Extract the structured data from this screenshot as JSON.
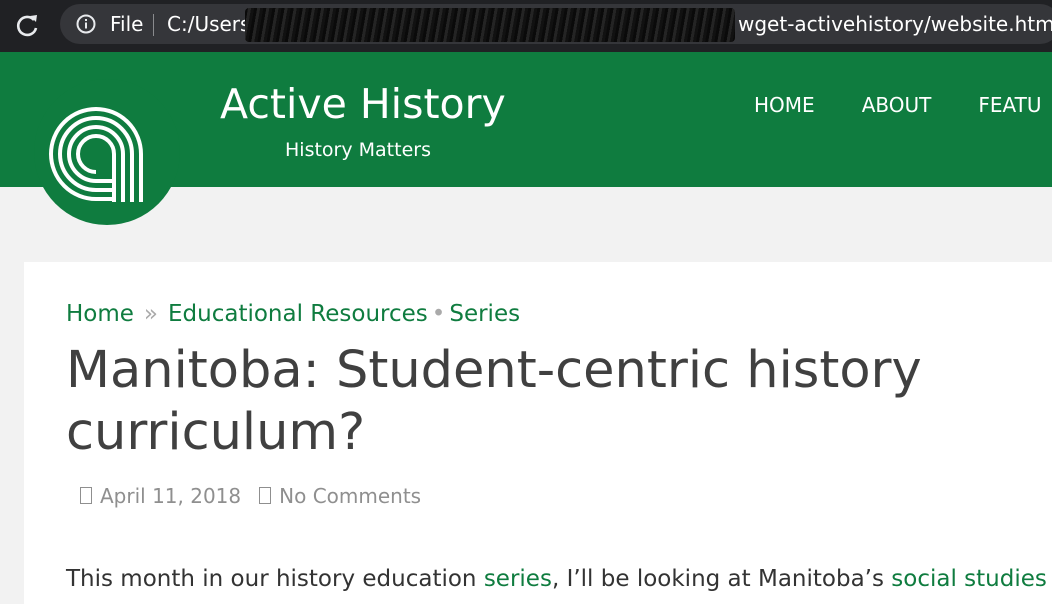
{
  "browser": {
    "scheme_label": "File",
    "url_start": "C:/Users",
    "url_end": "wget-activehistory/website.html"
  },
  "site": {
    "title": "Active History",
    "tagline": "History Matters",
    "brand_color": "#0f7c3f",
    "nav": [
      "HOME",
      "ABOUT",
      "FEATU"
    ]
  },
  "breadcrumb": {
    "home": "Home",
    "separator": "»",
    "category": "Educational Resources",
    "dot": "•",
    "subcategory": "Series"
  },
  "post": {
    "title": "Manitoba: Student-centric history curriculum?",
    "date": "April 11, 2018",
    "comments": "No Comments",
    "intro_1": "This month in our history education ",
    "intro_link_1": "series",
    "intro_2": ", I’ll be looking at Manitoba’s ",
    "intro_link_2": "social studies"
  }
}
